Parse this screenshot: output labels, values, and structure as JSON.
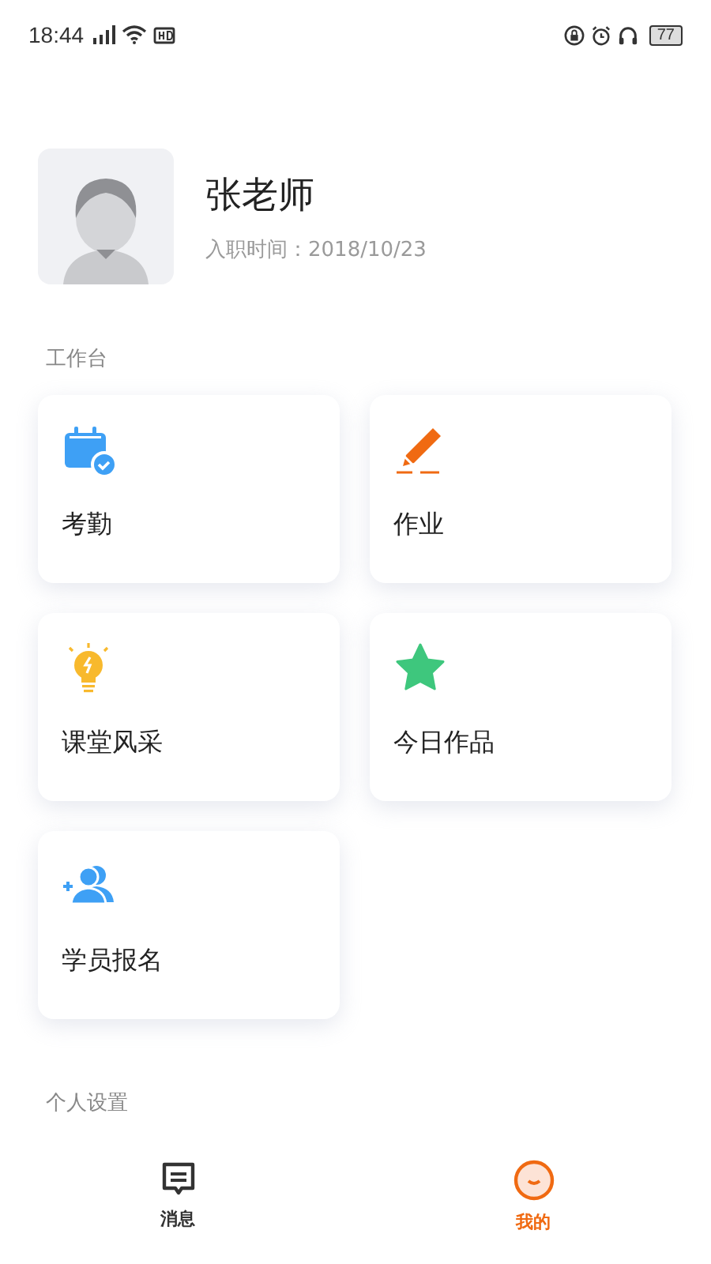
{
  "status_bar": {
    "time": "18:44",
    "battery": "77"
  },
  "profile": {
    "name": "张老师",
    "hire_date": "入职时间：2018/10/23"
  },
  "workbench": {
    "title": "工作台",
    "tiles": [
      {
        "label": "考勤",
        "kind": "calendar"
      },
      {
        "label": "作业",
        "kind": "pencil"
      },
      {
        "label": "课堂风采",
        "kind": "bulb"
      },
      {
        "label": "今日作品",
        "kind": "star"
      },
      {
        "label": "学员报名",
        "kind": "people"
      }
    ]
  },
  "settings": {
    "title": "个人设置"
  },
  "tab_bar": [
    {
      "label": "消息",
      "kind": "message",
      "selected": false
    },
    {
      "label": "我的",
      "kind": "me",
      "selected": true
    }
  ]
}
